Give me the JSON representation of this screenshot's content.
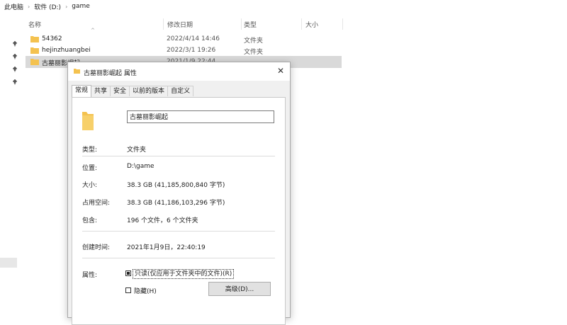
{
  "breadcrumb": {
    "items": [
      "此电脑",
      "软件 (D:)",
      "game"
    ]
  },
  "columns": {
    "name": "名称",
    "date": "修改日期",
    "type": "类型",
    "size": "大小"
  },
  "rows": [
    {
      "name": "54362",
      "date": "2022/4/14 14:46",
      "type": "文件夹"
    },
    {
      "name": "hejinzhuangbei",
      "date": "2022/3/1 19:26",
      "type": "文件夹"
    },
    {
      "name": "古墓丽影崛起",
      "date": "2021/1/9 22:44",
      "type": ""
    }
  ],
  "dialog": {
    "title": "古墓丽影崛起 属性",
    "close": "✕",
    "tabs": [
      "常规",
      "共享",
      "安全",
      "以前的版本",
      "自定义"
    ],
    "folder_name": "古墓丽影崛起",
    "type_label": "类型:",
    "type_value": "文件夹",
    "location_label": "位置:",
    "location_value": "D:\\game",
    "size_label": "大小:",
    "size_value": "38.3 GB (41,185,800,840 字节)",
    "disk_label": "占用空间:",
    "disk_value": "38.3 GB (41,186,103,296 字节)",
    "contains_label": "包含:",
    "contains_value": "196 个文件，6 个文件夹",
    "created_label": "创建时间:",
    "created_value": "2021年1月9日，22:40:19",
    "attr_label": "属性:",
    "readonly": "只读(仅应用于文件夹中的文件)(R)",
    "hidden": "隐藏(H)",
    "advanced": "高级(D)..."
  },
  "colors": {
    "folder": "#f4c24f",
    "selected_row": "#d9d9d9",
    "dialog_bg": "#f0f0f0"
  }
}
